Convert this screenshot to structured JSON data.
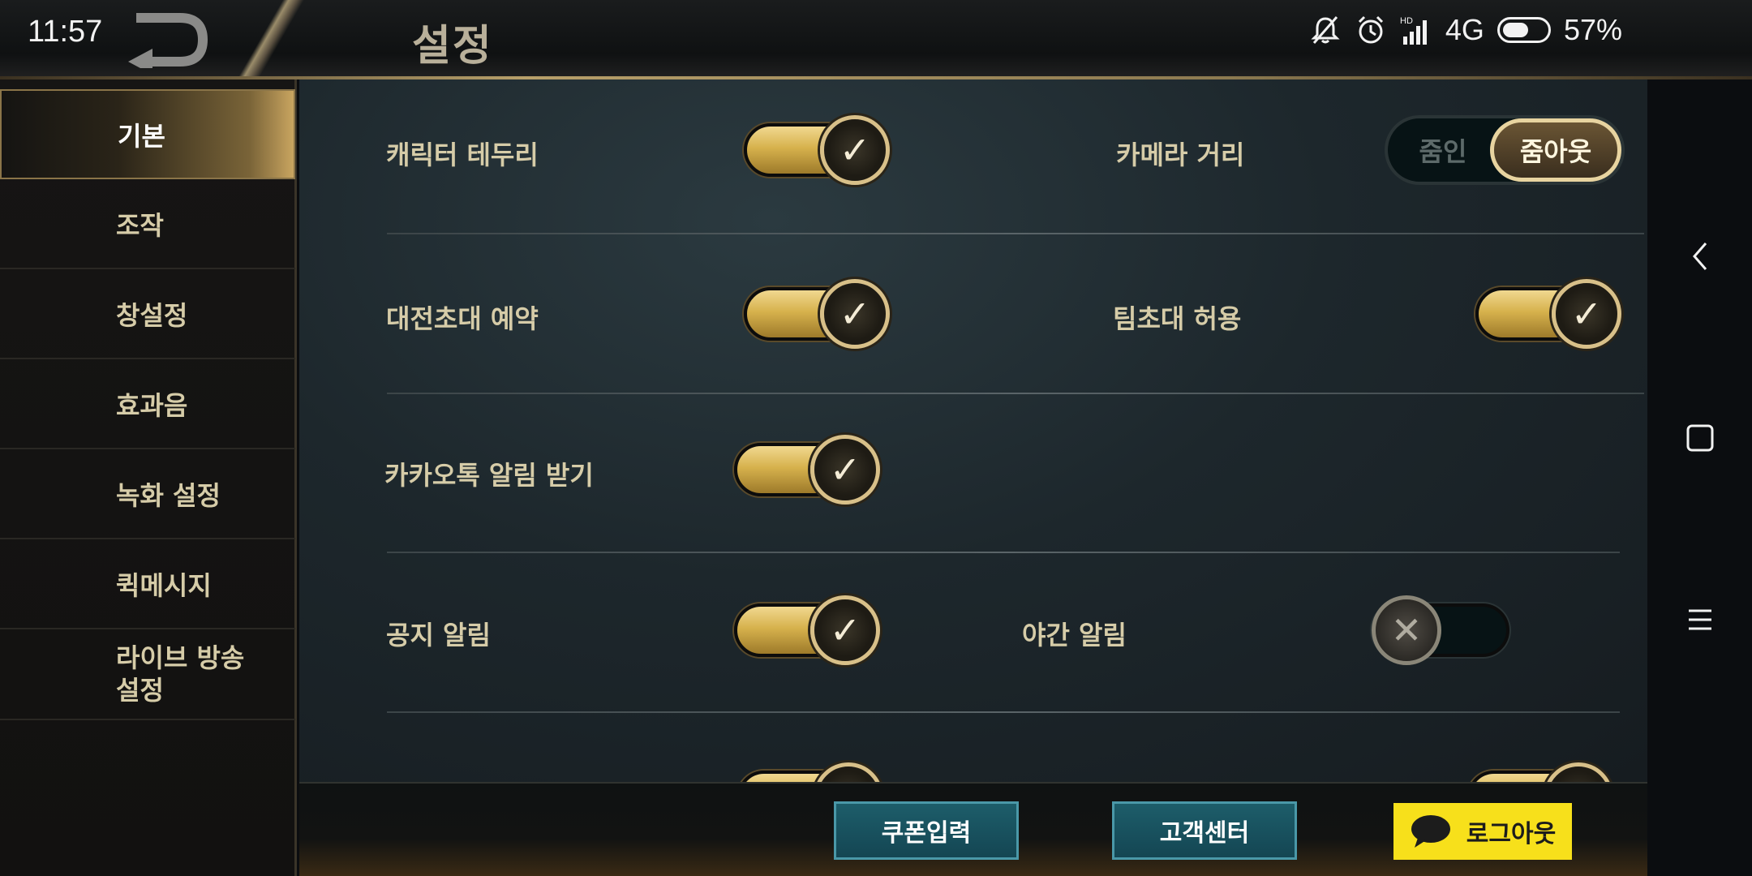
{
  "status_bar": {
    "time": "11:57",
    "network": "4G",
    "battery_percent": "57%",
    "battery_level": 0.57,
    "icons": [
      "bell-off-icon",
      "alarm-icon",
      "signal-icon",
      "battery-icon"
    ]
  },
  "header": {
    "title": "설정"
  },
  "sidebar": {
    "items": [
      {
        "label": "기본",
        "active": true
      },
      {
        "label": "조작",
        "active": false
      },
      {
        "label": "창설정",
        "active": false
      },
      {
        "label": "효과음",
        "active": false
      },
      {
        "label": "녹화 설정",
        "active": false
      },
      {
        "label": "퀵메시지",
        "active": false
      },
      {
        "label": "라이브 방송\n설정",
        "active": false
      }
    ]
  },
  "settings": {
    "character_outline": {
      "label": "캐릭터 테두리",
      "on": true
    },
    "camera_distance": {
      "label": "카메라 거리",
      "options": [
        "줌인",
        "줌아웃"
      ],
      "selected": "줌아웃"
    },
    "match_invite_reserve": {
      "label": "대전초대 예약",
      "on": true
    },
    "allow_team_invite": {
      "label": "팀초대 허용",
      "on": true
    },
    "kakaotalk_notify": {
      "label": "카카오톡 알림 받기",
      "on": true
    },
    "notice_notify": {
      "label": "공지 알림",
      "on": true
    },
    "night_notify": {
      "label": "야간 알림",
      "on": false
    }
  },
  "bottom_bar": {
    "coupon_label": "쿠폰입력",
    "support_label": "고객센터",
    "logout_label": "로그아웃"
  },
  "colors": {
    "gold": "#d7b24d",
    "kakao_yellow": "#f7e01b",
    "button_blue": "#144653"
  }
}
